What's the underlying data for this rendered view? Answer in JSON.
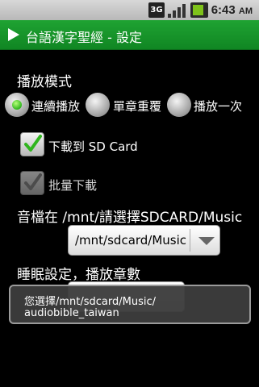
{
  "status_bar": {
    "network": "3G",
    "time": "6:43",
    "ampm": "AM",
    "icons": [
      "3g-icon",
      "signal-icon",
      "battery-icon"
    ]
  },
  "title_bar": {
    "title": "台語漢字聖經 - 設定"
  },
  "playback": {
    "heading": "播放模式",
    "options": [
      {
        "label": "連續播放",
        "selected": true
      },
      {
        "label": "單章重覆",
        "selected": false
      },
      {
        "label": "播放一次",
        "selected": false
      }
    ]
  },
  "download_sd": {
    "label": "下載到 SD Card",
    "checked": true
  },
  "batch_download": {
    "label": "批量下載",
    "checked": true,
    "enabled": false
  },
  "audio_location": {
    "label": "音檔在 /mnt/請選擇SDCARD/Music",
    "selected_value": "/mnt/sdcard/Music"
  },
  "sleep": {
    "label": "睡眠設定，播放章數"
  },
  "toast": {
    "line1": "您選擇/mnt/sdcard/Music/",
    "line2": "audiobible_taiwan"
  },
  "colors": {
    "title_bar": "#16962a",
    "accent_green": "#2fb51d"
  }
}
